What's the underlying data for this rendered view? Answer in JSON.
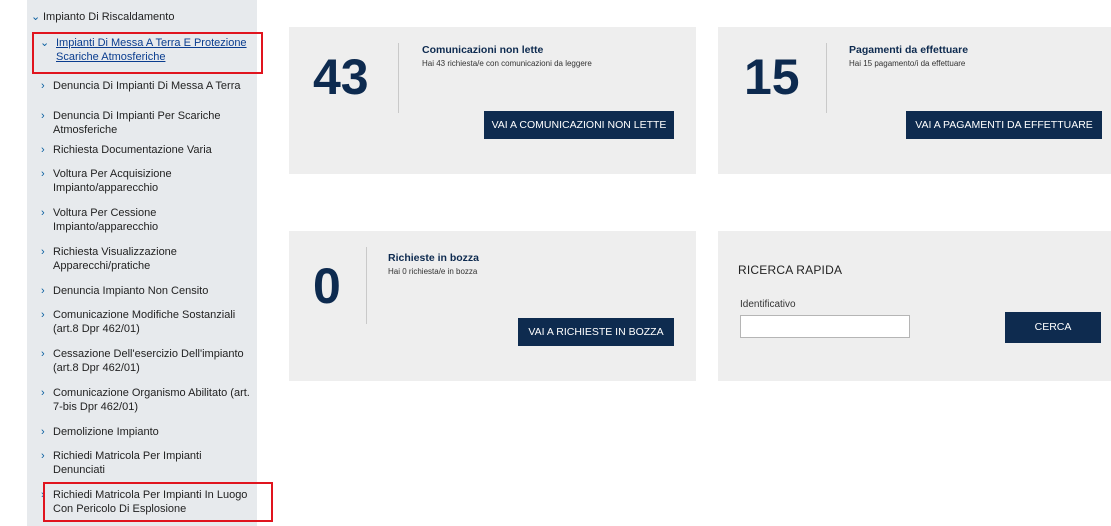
{
  "sidebar": {
    "top_item": "Impianto Di Riscaldamento",
    "parent_item": "Impianti Di Messa A Terra E Protezione Scariche Atmosferiche",
    "chevron_down": "⌄",
    "chevron_right": "›",
    "items": [
      "Denuncia Di Impianti Di Messa A Terra",
      "Denuncia Di Impianti Per Scariche Atmosferiche",
      "Richiesta Documentazione Varia",
      "Voltura Per Acquisizione Impianto/apparecchio",
      "Voltura Per Cessione Impianto/apparecchio",
      "Richiesta Visualizzazione Apparecchi/pratiche",
      "Denuncia Impianto Non Censito",
      "Comunicazione Modifiche Sostanziali (art.8 Dpr 462/01)",
      "Cessazione Dell'esercizio Dell'impianto (art.8 Dpr 462/01)",
      "Comunicazione Organismo Abilitato (art. 7-bis Dpr 462/01)",
      "Demolizione Impianto",
      "Richiedi Matricola Per Impianti Denunciati",
      "Richiedi Matricola Per Impianti In Luogo Con Pericolo Di Esplosione"
    ]
  },
  "cards": {
    "comunicazioni": {
      "count": "43",
      "title": "Comunicazioni non lette",
      "subtitle": "Hai 43 richiesta/e con comunicazioni da leggere",
      "button": "VAI A COMUNICAZIONI NON LETTE"
    },
    "pagamenti": {
      "count": "15",
      "title": "Pagamenti da effettuare",
      "subtitle": "Hai 15 pagamento/i da effettuare",
      "button": "VAI A PAGAMENTI DA EFFETTUARE"
    },
    "bozza": {
      "count": "0",
      "title": "Richieste in bozza",
      "subtitle": "Hai 0 richiesta/e in bozza",
      "button": "VAI A RICHIESTE IN BOZZA"
    }
  },
  "search": {
    "title": "RICERCA RAPIDA",
    "field_label": "Identificativo",
    "field_value": "",
    "button": "CERCA"
  },
  "colors": {
    "sidebar_bg": "#e7eaed",
    "card_bg": "#eeeeee",
    "button_bg": "#0e2b4f",
    "number_color": "#0d2a4f",
    "highlight": "#e0141e",
    "link": "#0a5fa0"
  }
}
